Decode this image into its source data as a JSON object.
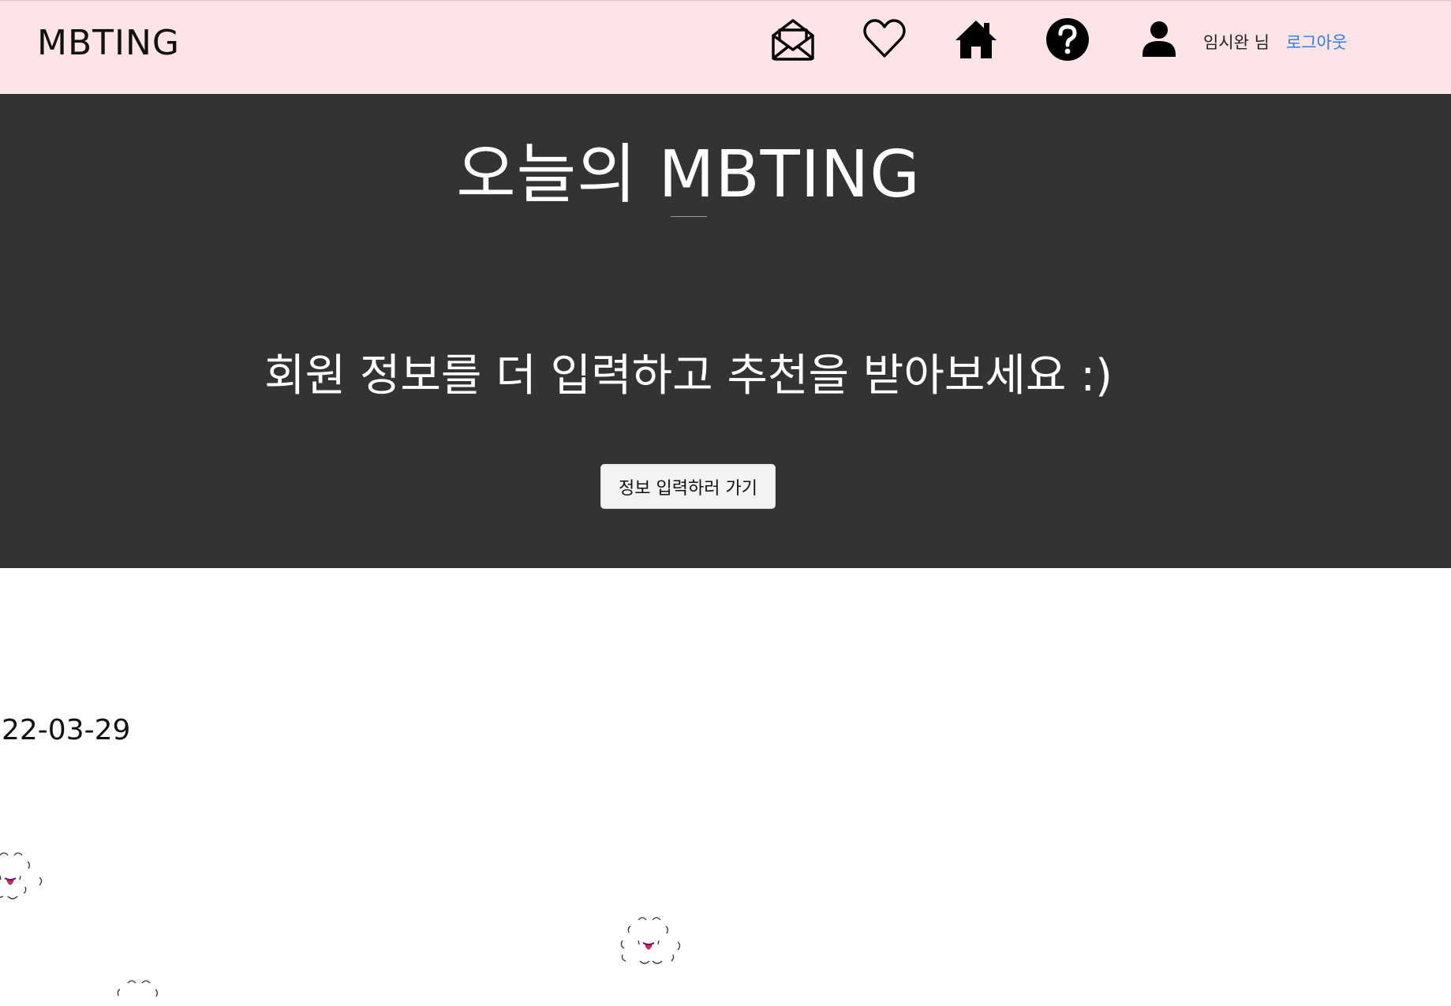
{
  "header": {
    "brand": "MBTING",
    "user_name": "임시완 님",
    "logout_label": "로그아웃",
    "icons": [
      "envelope-icon",
      "heart-icon",
      "home-icon",
      "help-icon",
      "user-icon"
    ],
    "background_color": "#fde4e6",
    "logout_color": "#2b7de9"
  },
  "hero": {
    "title": "오늘의 MBTING",
    "subtitle": "회원 정보를 더 입력하고 추천을 받아보세요 :)",
    "button_label": "정보 입력하러 가기",
    "background_color": "#333333"
  },
  "main": {
    "date": "22-03-29",
    "ghost_icons": [
      "ghost-icon",
      "ghost-icon",
      "ghost-icon"
    ]
  }
}
